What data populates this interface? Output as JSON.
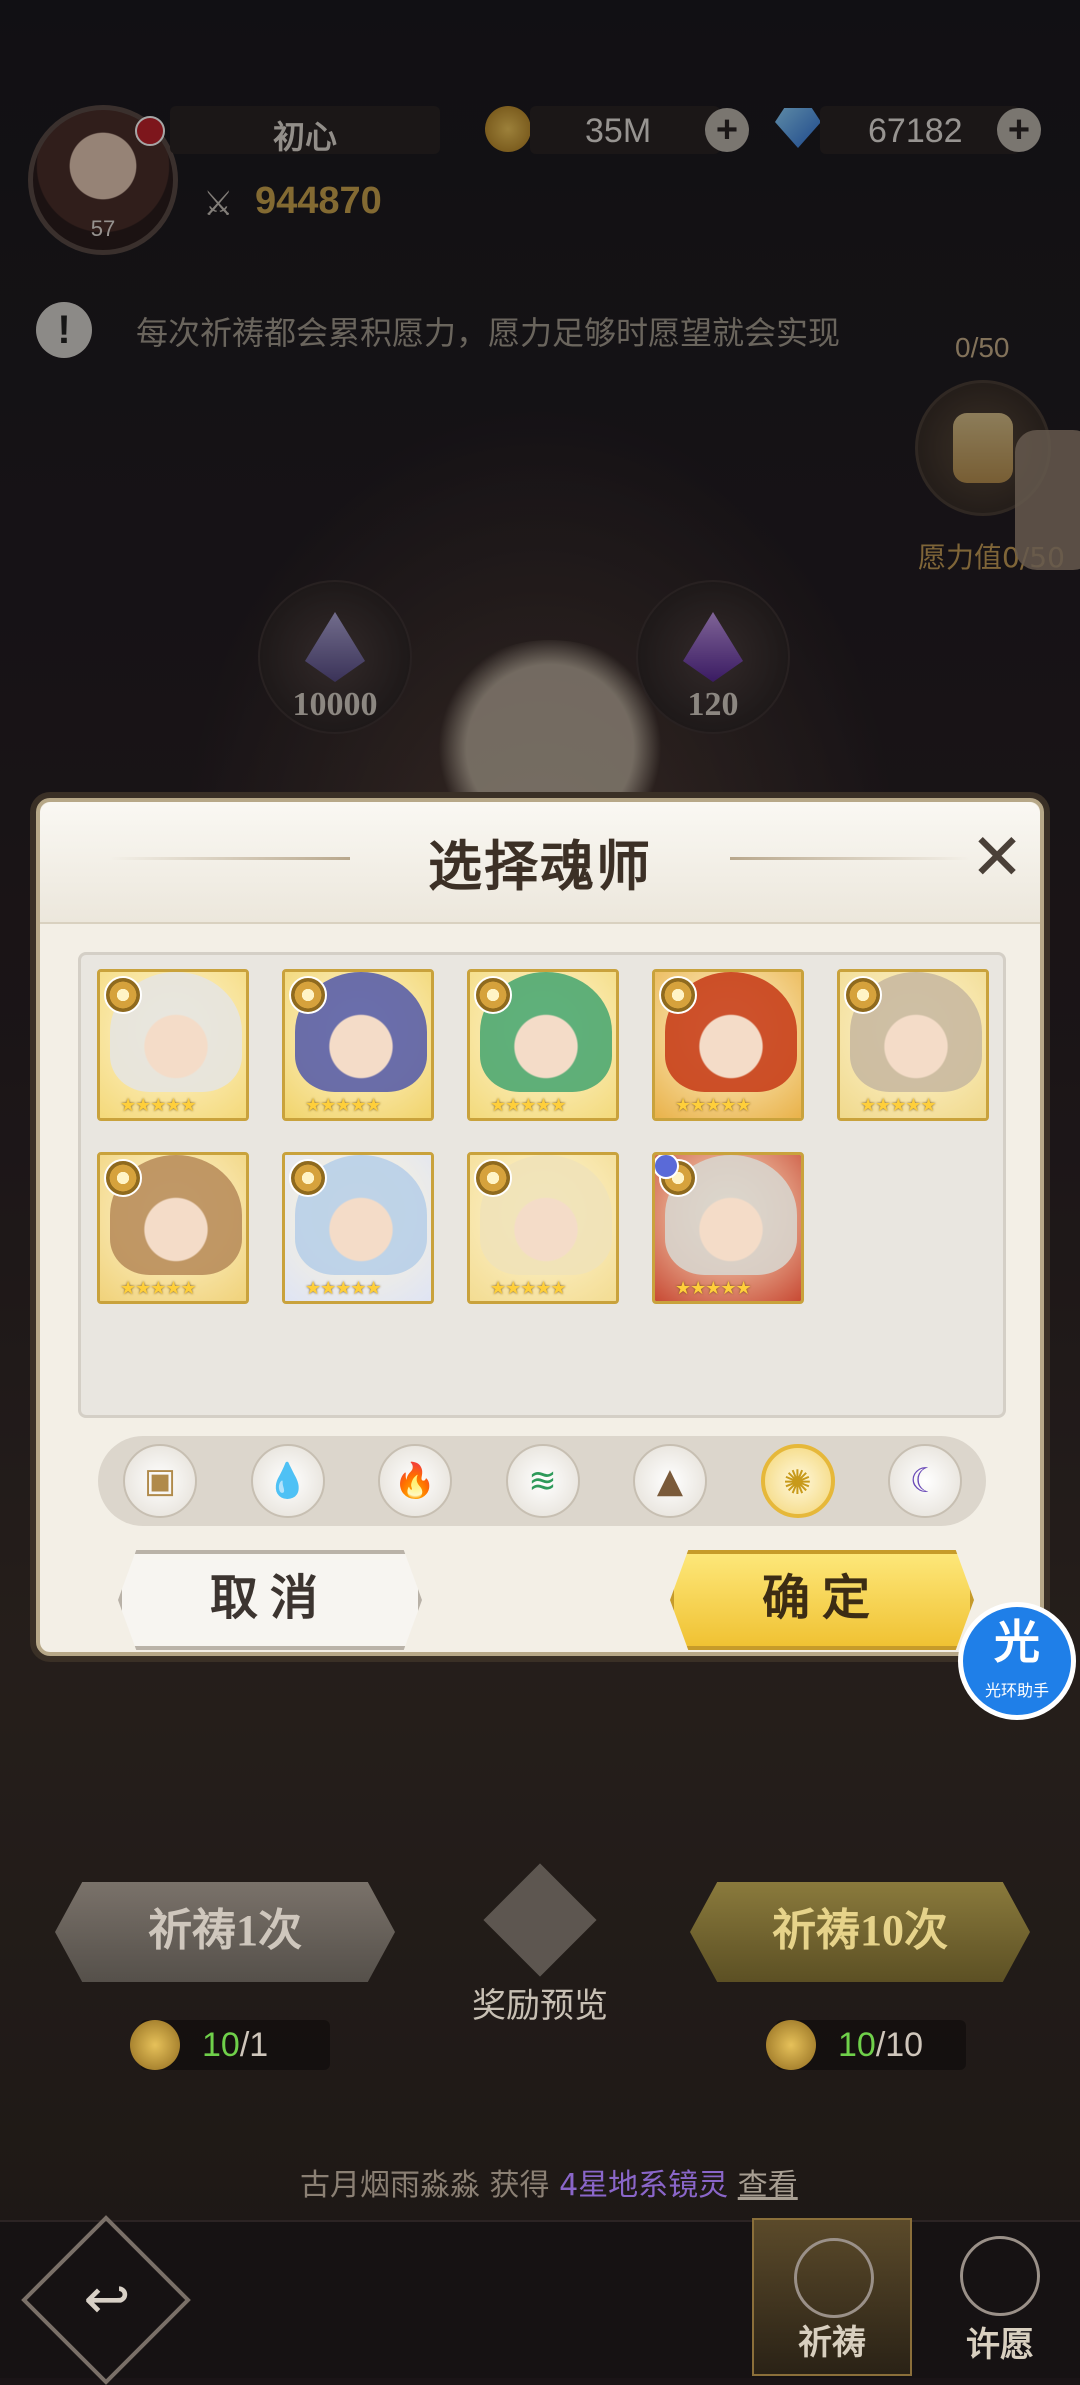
{
  "player": {
    "name": "初心",
    "level": "57",
    "gold": "35M",
    "diamonds": "67182",
    "power": "944870"
  },
  "tip": "每次祈祷都会累积愿力，愿力足够时愿望就会实现",
  "wish": {
    "count": "0/50",
    "label": "愿力值0/50"
  },
  "orbs": [
    {
      "value": "10000"
    },
    {
      "value": "120"
    }
  ],
  "dialog": {
    "title": "选择魂师",
    "cards": [
      {
        "stars": "★★★★★",
        "hair": "#e6e4e0",
        "bg": "#f4d97a"
      },
      {
        "stars": "★★★★★",
        "hair": "#5a5fa8",
        "bg": "#f1d46c"
      },
      {
        "stars": "★★★★★",
        "hair": "#4ea872",
        "bg": "#f3da7c"
      },
      {
        "stars": "★★★★★",
        "hair": "#c8401c",
        "bg": "#e9b24a"
      },
      {
        "stars": "★★★★★",
        "hair": "#c9b9a0",
        "bg": "#f0d98c"
      },
      {
        "stars": "★★★★★",
        "hair": "#b98e5c",
        "bg": "#f0d27a"
      },
      {
        "stars": "★★★★★",
        "hair": "#b8cfe8",
        "bg": "#dfe4f4"
      },
      {
        "stars": "★★★★★",
        "hair": "#efe2b8",
        "bg": "#f3dc92"
      },
      {
        "stars": "★★★★★",
        "hair": "#d8d4cc",
        "bg": "#c84a34"
      }
    ],
    "filters": [
      {
        "name": "all",
        "glyph": "▣",
        "color": "#b08a4a"
      },
      {
        "name": "water",
        "glyph": "💧",
        "color": "#2a8ad8"
      },
      {
        "name": "fire",
        "glyph": "🔥",
        "color": "#d8402a"
      },
      {
        "name": "wind",
        "glyph": "≋",
        "color": "#2e9a5a"
      },
      {
        "name": "earth",
        "glyph": "▲",
        "color": "#7a5a3a"
      },
      {
        "name": "light",
        "glyph": "✺",
        "color": "#c89a1a"
      },
      {
        "name": "dark",
        "glyph": "☾",
        "color": "#6a4ab8"
      }
    ],
    "cancel": "取消",
    "confirm": "确定"
  },
  "helper": {
    "big": "光",
    "small": "光环助手"
  },
  "actions": {
    "pray_one": "祈祷1次",
    "pray_ten": "祈祷10次",
    "preview": "奖励预览",
    "cost_one": {
      "have": "10",
      "need": "/1"
    },
    "cost_ten": {
      "have": "10",
      "need": "/10"
    }
  },
  "news": {
    "player": "古月烟雨淼淼",
    "verb": "获得",
    "item": "4星地系镜灵",
    "link": "查看"
  },
  "nav": {
    "pray": "祈祷",
    "wish": "许愿"
  }
}
